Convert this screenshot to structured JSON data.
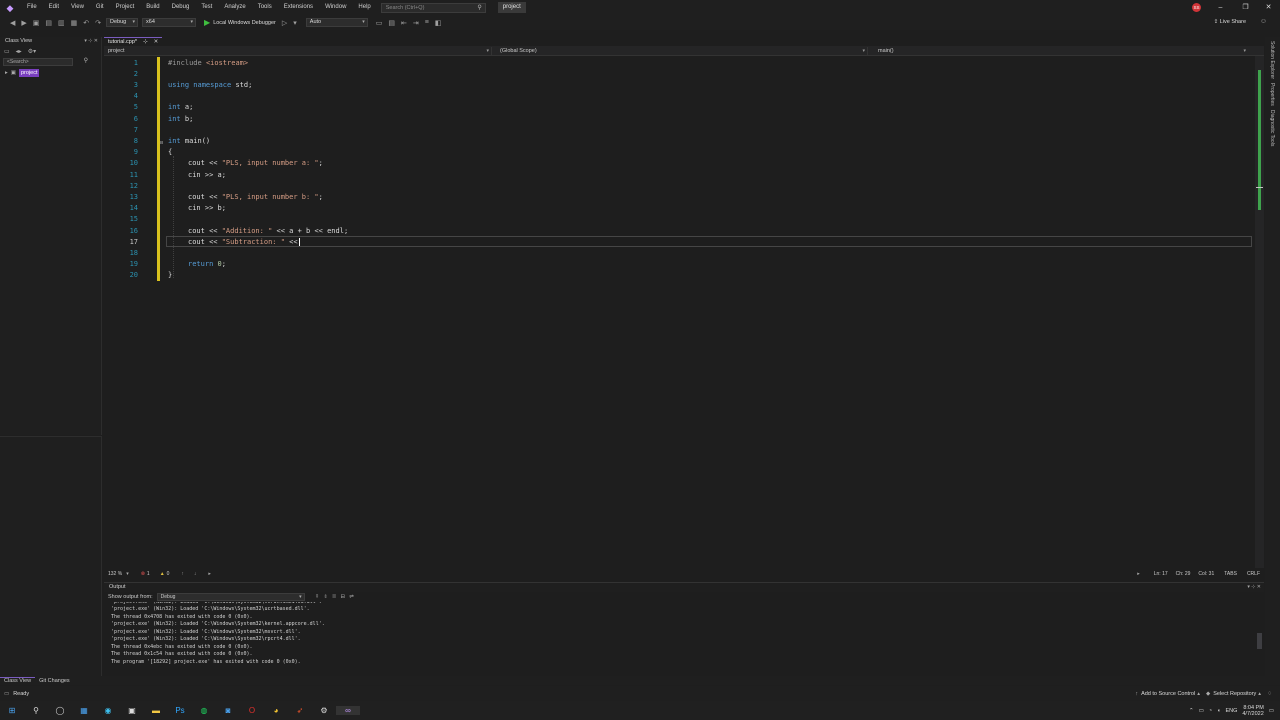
{
  "titlebar": {
    "menu": [
      "File",
      "Edit",
      "View",
      "Git",
      "Project",
      "Build",
      "Debug",
      "Test",
      "Analyze",
      "Tools",
      "Extensions",
      "Window",
      "Help"
    ],
    "search_placeholder": "Search (Ctrl+Q)",
    "solution_name": "project",
    "avatar_initials": "SS"
  },
  "toolbar": {
    "config": "Debug",
    "platform": "x64",
    "debugger": "Local Windows Debugger",
    "mode": "Auto",
    "live_share": "Live Share"
  },
  "class_view": {
    "title": "Class View",
    "search_placeholder": "<Search>",
    "tree_item": "project"
  },
  "editor": {
    "tab_label": "tutorial.cpp*",
    "tab_pin": "⊹",
    "project_dropdown": "project",
    "scope_dropdown": "(Global Scope)",
    "member_dropdown": "main()",
    "lines": [
      {
        "n": "1",
        "t": "#include <iostream>"
      },
      {
        "n": "2",
        "t": ""
      },
      {
        "n": "3",
        "t": "using namespace std;"
      },
      {
        "n": "4",
        "t": ""
      },
      {
        "n": "5",
        "t": "int a;"
      },
      {
        "n": "6",
        "t": "int b;"
      },
      {
        "n": "7",
        "t": ""
      },
      {
        "n": "8",
        "t": "int main()"
      },
      {
        "n": "9",
        "t": "{"
      },
      {
        "n": "10",
        "t": "cout << \"PLS, input number a: \";"
      },
      {
        "n": "11",
        "t": "cin >> a;"
      },
      {
        "n": "12",
        "t": ""
      },
      {
        "n": "13",
        "t": "cout << \"PLS, input number b: \";"
      },
      {
        "n": "14",
        "t": "cin >> b;"
      },
      {
        "n": "15",
        "t": ""
      },
      {
        "n": "16",
        "t": "cout << \"Addition: \" << a + b << endl;"
      },
      {
        "n": "17",
        "t": "cout << \"Subtraction: \" <<"
      },
      {
        "n": "18",
        "t": ""
      },
      {
        "n": "19",
        "t": "return 0;"
      },
      {
        "n": "20",
        "t": "}"
      }
    ]
  },
  "editor_status": {
    "zoom": "132 %",
    "errors": "1",
    "warnings": "0",
    "ln": "Ln: 17",
    "ch": "Ch: 29",
    "col": "Col: 31",
    "tabs": "TABS",
    "eol": "CRLF"
  },
  "output": {
    "title": "Output",
    "show_from_label": "Show output from:",
    "source": "Debug",
    "lines": [
      "'project.exe' (Win32): Loaded 'C:\\Windows\\System32\\vcruntime140d.dll'.",
      "'project.exe' (Win32): Loaded 'C:\\Windows\\System32\\ucrtbased.dll'.",
      "The thread 0x4708 has exited with code 0 (0x0).",
      "'project.exe' (Win32): Loaded 'C:\\Windows\\System32\\kernel.appcore.dll'.",
      "'project.exe' (Win32): Loaded 'C:\\Windows\\System32\\msvcrt.dll'.",
      "'project.exe' (Win32): Loaded 'C:\\Windows\\System32\\rpcrt4.dll'.",
      "The thread 0x4ebc has exited with code 0 (0x0).",
      "The thread 0x1c54 has exited with code 0 (0x0).",
      "The program '[18292] project.exe' has exited with code 0 (0x0)."
    ]
  },
  "bottom_tabs": [
    "Class View",
    "Git Changes"
  ],
  "statusbar": {
    "ready": "Ready",
    "source_control": "Add to Source Control",
    "repository": "Select Repository"
  },
  "taskbar": {
    "lang": "ENG",
    "time": "8:04 PM",
    "date": "4/7/2022"
  },
  "right_sidebar": [
    "Solution Explorer",
    "Properties",
    "Diagnostic Tools"
  ],
  "colors": {
    "accent": "#7a3fbf",
    "change_bar": "#d9c21e",
    "keyword": "#569cd6",
    "string": "#d69d85"
  }
}
